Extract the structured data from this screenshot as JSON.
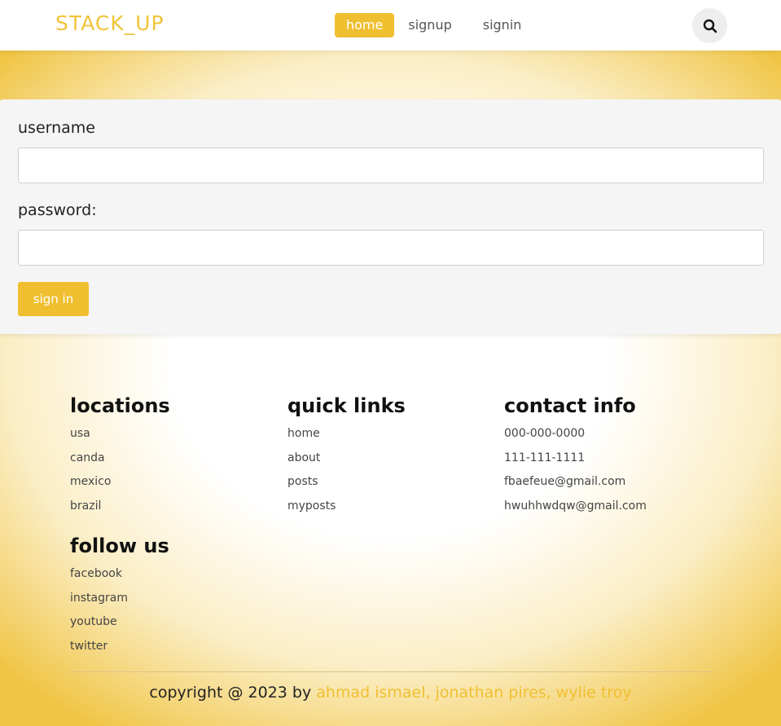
{
  "header": {
    "logo": "STACK_UP",
    "nav": {
      "home": "home",
      "signup": "signup",
      "signin": "signin"
    },
    "search_icon": "search-icon"
  },
  "form": {
    "username_label": "username",
    "username_value": "",
    "password_label": "password:",
    "password_value": "",
    "submit_label": "sign in"
  },
  "footer": {
    "locations": {
      "title": "locations",
      "items": [
        "usa",
        "canda",
        "mexico",
        "brazil"
      ]
    },
    "quick_links": {
      "title": "quick links",
      "items": [
        "home",
        "about",
        "posts",
        "myposts"
      ]
    },
    "contact_info": {
      "title": "contact info",
      "items": [
        "000-000-0000",
        "111-111-1111",
        "fbaefeue@gmail.com",
        "hwuhhwdqw@gmail.com"
      ]
    },
    "follow_us": {
      "title": "follow us",
      "items": [
        "facebook",
        "instagram",
        "youtube",
        "twitter"
      ]
    },
    "copyright_prefix": "copyright @ 2023 by",
    "copyright_authors": "ahmad ismael, jonathan pires, wylie troy"
  },
  "colors": {
    "accent": "#f0bf30",
    "background_edge": "#f0c443"
  }
}
